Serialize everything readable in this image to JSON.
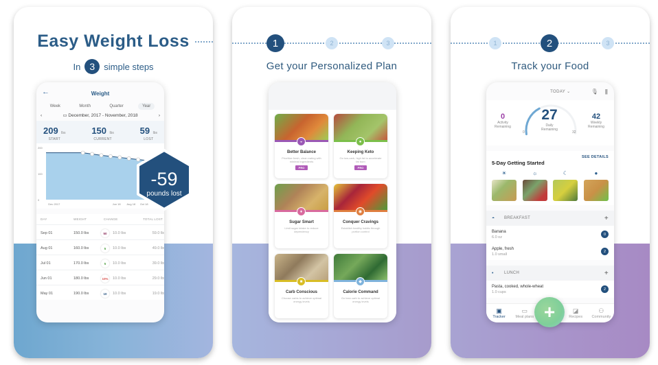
{
  "panel1": {
    "headline": "Easy Weight Loss",
    "sub_prefix": "In",
    "sub_number": "3",
    "sub_suffix": "simple steps",
    "screen": {
      "back_icon": "arrow-left-icon",
      "title": "Weight",
      "segments": [
        "Week",
        "Month",
        "Quarter",
        "Year"
      ],
      "selected_segment": "Year",
      "range": "December, 2017 - November, 2018",
      "stats": [
        {
          "value": "209",
          "unit": "lbs",
          "label": "START"
        },
        {
          "value": "150",
          "unit": "lbs",
          "label": "CURRENT"
        },
        {
          "value": "59",
          "unit": "lbs",
          "label": "LOST"
        }
      ],
      "chart": {
        "y_ticks": [
          "200",
          "100",
          "0"
        ],
        "x_ticks": [
          "Dec 2017",
          "Jun 18",
          "Aug 18",
          "Oct 18"
        ],
        "ylim": [
          0,
          200
        ],
        "values": [
          180,
          180,
          180,
          180,
          180,
          175,
          170,
          166,
          162,
          158,
          154,
          150,
          150
        ],
        "accent": "#a9d1ec",
        "line_color": "#23507d"
      },
      "table_headers": [
        "DAY",
        "WEIGHT",
        "CHANGE",
        "TOTAL LOST"
      ],
      "rows": [
        {
          "day": "Sep 01",
          "weight": "150.0 lbs",
          "badge": "50",
          "badge_color": "#8b2d5a",
          "change": "10.0 lbs",
          "total": "59.0 lbs"
        },
        {
          "day": "Aug 01",
          "weight": "160.0 lbs",
          "badge": "5",
          "badge_color": "#4b9b3c",
          "change": "10.0 lbs",
          "total": "49.0 lbs"
        },
        {
          "day": "Jul 01",
          "weight": "170.0 lbs",
          "badge": "5",
          "badge_color": "#4b9b3c",
          "change": "10.0 lbs",
          "total": "39.0 lbs"
        },
        {
          "day": "Jun 01",
          "weight": "180.0 lbs",
          "badge": "10%",
          "badge_color": "#d9534f",
          "change": "10.0 lbs",
          "total": "29.0 lbs"
        },
        {
          "day": "May 01",
          "weight": "190.0 lbs",
          "badge": "10",
          "badge_color": "#23507d",
          "change": "10.0 lbs",
          "total": "19.0 lbs"
        }
      ]
    },
    "hex_badge": {
      "value": "-59",
      "label": "pounds lost"
    }
  },
  "panel2": {
    "steps": [
      "1",
      "2",
      "3"
    ],
    "active_step": 0,
    "title": "Get your Personalized Plan",
    "plans": [
      {
        "name": "Better Balance",
        "desc": "Prioritize fresh, clean eating with minimal ingredients",
        "pro": "PRO",
        "color": "#9a58b5",
        "img": "linear-gradient(135deg,#6fae4a 0%,#c8642f 45%,#e08a3b 70%,#9ccc55 100%)",
        "icon": "bowl-icon",
        "glyph": "◒"
      },
      {
        "name": "Keeping Keto",
        "desc": "Go low-carb, high fat to accelerate fat burn",
        "pro": "PRO",
        "color": "#7bbf4a",
        "img": "linear-gradient(135deg,#b64b3e 0%,#92b657 40%,#a4c46a 70%,#c4583f 100%)",
        "icon": "avocado-icon",
        "glyph": "●"
      },
      {
        "name": "Sugar Smart",
        "desc": "Limit sugar intake to reduce dependency",
        "pro": "",
        "color": "#d86a9e",
        "img": "linear-gradient(135deg,#6ea04c 0%,#b08358 40%,#d7b36a 70%,#c99e44 100%)",
        "icon": "lollipop-icon",
        "glyph": "♦"
      },
      {
        "name": "Conquer Cravings",
        "desc": "Establish healthy habits through portion control",
        "pro": "",
        "color": "#df7e3f",
        "img": "linear-gradient(135deg,#e4c43a 0%,#a8253a 35%,#e04b2a 60%,#4c9a3a 100%)",
        "icon": "plate-icon",
        "glyph": "◉"
      },
      {
        "name": "Carb Conscious",
        "desc": "Choose carbs to achieve optimal energy levels",
        "pro": "",
        "color": "#d8bd25",
        "img": "linear-gradient(135deg,#c9b48a 0%,#8f7a5c 40%,#d3c4a4 70%,#b9a27c 100%)",
        "icon": "bread-icon",
        "glyph": "■"
      },
      {
        "name": "Calorie Command",
        "desc": "Go lean carb to achieve optimal energy levels",
        "pro": "",
        "color": "#7fb3dc",
        "img": "linear-gradient(135deg,#3f7a3a 0%,#75a85a 40%,#2f6a33 70%,#8cbf6c 100%)",
        "icon": "droplet-icon",
        "glyph": "◆"
      }
    ]
  },
  "panel3": {
    "steps": [
      "1",
      "2",
      "3"
    ],
    "active_step": 1,
    "title": "Track your Food",
    "screen": {
      "date_label": "TODAY",
      "mic_icon": "microphone-icon",
      "barcode_icon": "barcode-icon",
      "activity": {
        "value": "0",
        "label1": "Activity",
        "label2": "Remaining",
        "color": "#9b3fa6"
      },
      "daily": {
        "value": "27",
        "label1": "Daily",
        "label2": "Remaining",
        "min": "0",
        "max": "32",
        "progress": 0.16
      },
      "weekly": {
        "value": "42",
        "label1": "Weekly",
        "label2": "Remaining"
      },
      "see_details": "SEE DETAILS",
      "section_title": "5-Day Getting Started",
      "foods": [
        {
          "icon": "sunrise-icon",
          "glyph": "☀",
          "img": "linear-gradient(135deg,#e7e4c7 0%,#9bb86b 40%,#c79b53 100%)"
        },
        {
          "icon": "sun-icon",
          "glyph": "☼",
          "img": "linear-gradient(135deg,#6b4a3a 0%,#7aa36b 40%,#c23b3b 80%)"
        },
        {
          "icon": "moon-icon",
          "glyph": "☾",
          "img": "linear-gradient(135deg,#b3c95a 0%,#d6cf3e 50%,#4f7a3a 100%)"
        },
        {
          "icon": "apple-icon",
          "glyph": "●",
          "img": "linear-gradient(135deg,#d3a45a 0%,#c99147 50%,#6fc04a 100%)"
        }
      ],
      "meals": [
        {
          "name": "BREAKFAST",
          "icon": "sunrise-icon",
          "glyph": "◓",
          "items": [
            {
              "name": "Banana",
              "amount": "6.0 oz",
              "count": "0"
            },
            {
              "name": "Apple, fresh",
              "amount": "1.0 small",
              "count": "2"
            }
          ]
        },
        {
          "name": "LUNCH",
          "icon": "sun-icon",
          "glyph": "•",
          "items": [
            {
              "name": "Pasta, cooked, whole-wheat",
              "amount": "1.0 cups",
              "count": "2"
            }
          ]
        }
      ],
      "nav": [
        {
          "label": "Tracker",
          "icon": "clipboard-icon",
          "glyph": "▣",
          "active": true
        },
        {
          "label": "Meal plans",
          "icon": "meal-plan-icon",
          "glyph": "▭",
          "active": false
        },
        {
          "label": "",
          "icon": "",
          "glyph": "",
          "active": false
        },
        {
          "label": "Recipes",
          "icon": "recipe-icon",
          "glyph": "◪",
          "active": false
        },
        {
          "label": "Community",
          "icon": "community-icon",
          "glyph": "⚇",
          "active": false
        }
      ],
      "fab_label": "+"
    }
  }
}
